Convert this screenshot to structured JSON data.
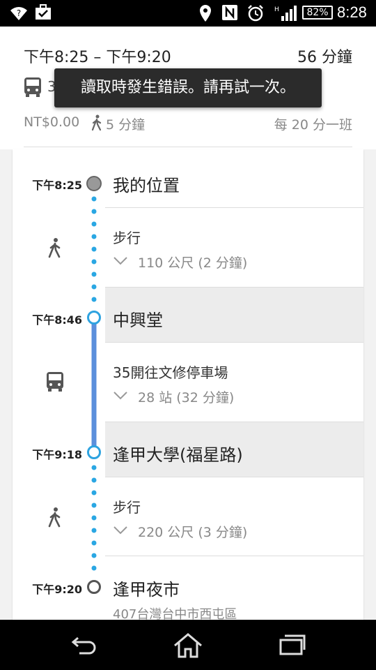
{
  "status_bar": {
    "battery": "82%",
    "clock": "8:28",
    "icons": [
      "wifi-unknown-icon",
      "briefcase-check-icon",
      "location-icon",
      "nfc-icon",
      "alarm-icon",
      "signal-icon",
      "battery-icon"
    ]
  },
  "summary": {
    "time_range": "下午8:25 – 下午9:20",
    "duration": "56 分鐘",
    "route_number": "3",
    "fare": "NT$0.00",
    "walk_time": "5 分鐘",
    "frequency": "每 20 分一班"
  },
  "toast": "讀取時發生錯誤。請再試一次。",
  "steps": {
    "start": {
      "time": "下午8:25",
      "name": "我的位置"
    },
    "walk1": {
      "title": "步行",
      "detail": "110 公尺 (2 分鐘)"
    },
    "stop1": {
      "time": "下午8:46",
      "name": "中興堂"
    },
    "bus": {
      "title": "35開往文修停車場",
      "detail": "28 站 (32 分鐘)"
    },
    "stop2": {
      "time": "下午9:18",
      "name": "逢甲大學(福星路)"
    },
    "walk2": {
      "title": "步行",
      "detail": "220 公尺 (3 分鐘)"
    },
    "end": {
      "time": "下午9:20",
      "name": "逢甲夜市",
      "address": "407台灣台中市西屯區"
    }
  },
  "colors": {
    "transit_line": "#5b8fdc",
    "dot_blue": "#2ea3e0",
    "walk_dots": "#2aa7e3"
  },
  "nav_bar": {
    "buttons": [
      "back-icon",
      "home-icon",
      "recents-icon"
    ]
  }
}
